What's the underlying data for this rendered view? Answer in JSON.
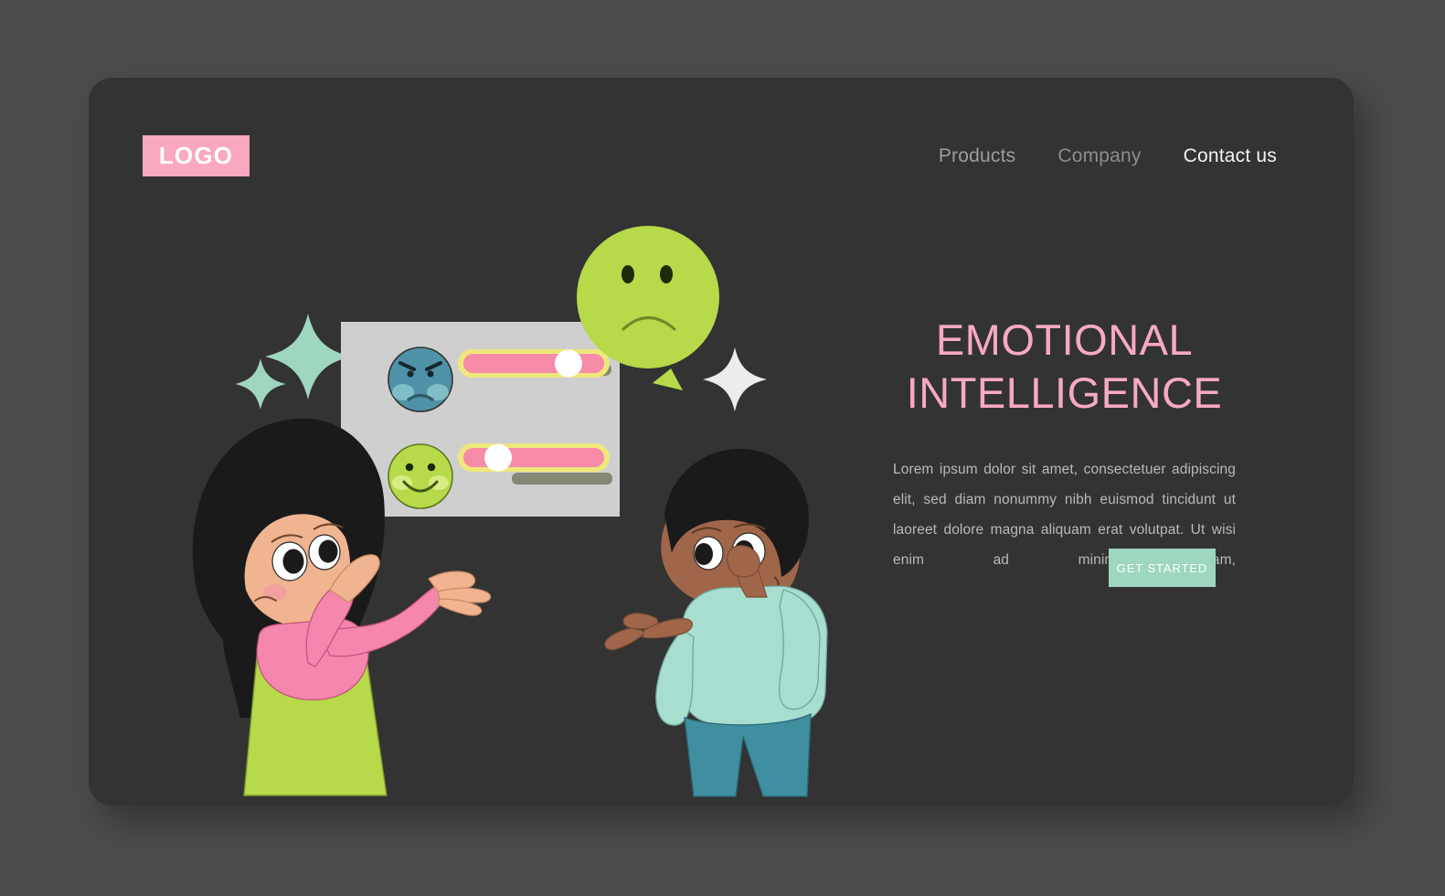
{
  "page": {
    "background_color": "#4b4b4b",
    "card_color": "#333333"
  },
  "header": {
    "logo_label": "LOGO",
    "logo_bg": "#f9a8bf",
    "nav": [
      {
        "label": "Products",
        "state": "default"
      },
      {
        "label": "Company",
        "state": "default"
      },
      {
        "label": "Contact us",
        "state": "active"
      }
    ]
  },
  "hero": {
    "headline_line1": "EMOTIONAL",
    "headline_line2": "INTELLIGENCE",
    "headline_color": "#f7a9c4",
    "paragraph": "Lorem ipsum dolor sit amet, consectetuer adipiscing elit, sed diam nonummy nibh euismod tincidunt ut laoreet dolore magna aliquam erat volutpat. Ut wisi enim ad minim veniam,",
    "cta_label": "GET STARTED",
    "cta_bg": "#9ed6c0"
  },
  "illustration": {
    "panel": {
      "fill": "#cfcfcf",
      "sliders": [
        {
          "emoji": "angry-face",
          "emoji_fill": "#4f92a8",
          "track_fill": "#f58ba6",
          "track_border": "#eee87a",
          "knob_fill": "#ffffff",
          "value_percent": 78
        },
        {
          "emoji": "happy-face",
          "emoji_fill": "#b7d94a",
          "track_fill": "#f58ba6",
          "track_border": "#eee87a",
          "knob_fill": "#ffffff",
          "value_percent": 25
        }
      ]
    },
    "speech_bubble": {
      "expression": "sad-face",
      "fill": "#b7d94a"
    },
    "sparkles": [
      {
        "name": "sparkle-large-left",
        "color": "#9ed6c0"
      },
      {
        "name": "sparkle-small-left",
        "color": "#9ed6c0"
      },
      {
        "name": "sparkle-right",
        "color": "#ececec"
      }
    ],
    "characters": [
      {
        "name": "girl-character",
        "hair": "#1a1a1a",
        "skin": "#f0b490",
        "top": "#f587ae",
        "bottom": "#b7d94a",
        "pose": "hand-on-chin-thinking"
      },
      {
        "name": "boy-character",
        "hair": "#1a1a1a",
        "skin": "#a0664a",
        "top": "#a8ded0",
        "bottom": "#3f8fa0",
        "pose": "hand-on-chin-puzzled"
      }
    ]
  }
}
